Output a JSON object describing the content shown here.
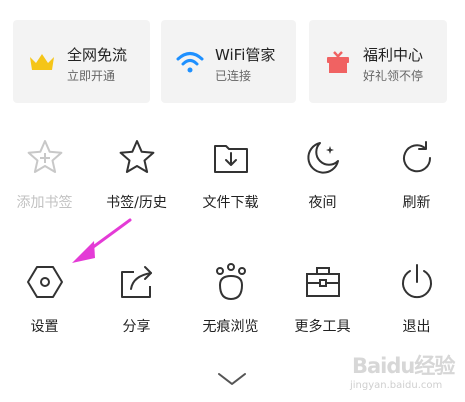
{
  "cards": [
    {
      "title": "全网免流",
      "subtitle": "立即开通",
      "icon": "crown-icon",
      "color": "#f5c518"
    },
    {
      "title": "WiFi管家",
      "subtitle": "已连接",
      "icon": "wifi-icon",
      "color": "#1e90ff"
    },
    {
      "title": "福利中心",
      "subtitle": "好礼领不停",
      "icon": "gift-icon",
      "color": "#f06262"
    }
  ],
  "grid": [
    {
      "label": "添加书签",
      "icon": "star-plus-icon",
      "enabled": false
    },
    {
      "label": "书签/历史",
      "icon": "star-icon",
      "enabled": true
    },
    {
      "label": "文件下载",
      "icon": "download-folder-icon",
      "enabled": true
    },
    {
      "label": "夜间",
      "icon": "moon-icon",
      "enabled": true
    },
    {
      "label": "刷新",
      "icon": "refresh-icon",
      "enabled": true
    },
    {
      "label": "设置",
      "icon": "hexagon-settings-icon",
      "enabled": true
    },
    {
      "label": "分享",
      "icon": "share-icon",
      "enabled": true
    },
    {
      "label": "无痕浏览",
      "icon": "paw-icon",
      "enabled": true
    },
    {
      "label": "更多工具",
      "icon": "toolbox-icon",
      "enabled": true
    },
    {
      "label": "退出",
      "icon": "power-icon",
      "enabled": true
    }
  ],
  "collapse_icon": "chevron-down-icon",
  "annotation_color": "#e43bd6",
  "watermark": {
    "brand": "Baidu经验",
    "url": "jingyan.baidu.com"
  }
}
